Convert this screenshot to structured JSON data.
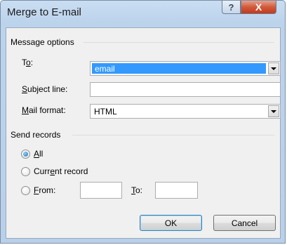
{
  "window": {
    "title": "Merge to E-mail"
  },
  "title_buttons": {
    "help_glyph": "?",
    "close_glyph": "X"
  },
  "message_options": {
    "group_label": "Message options",
    "to": {
      "label_pre": "T",
      "label_key": "o",
      "label_post": ":",
      "value": "email"
    },
    "subject": {
      "label_key": "S",
      "label_post": "ubject line:",
      "value": ""
    },
    "mail_format": {
      "label_key": "M",
      "label_post": "ail format:",
      "value": "HTML"
    }
  },
  "send_records": {
    "group_label": "Send records",
    "all": {
      "label_key": "A",
      "label_post": "ll",
      "checked": true
    },
    "current": {
      "label_pre": "Curr",
      "label_key": "e",
      "label_post": "nt record",
      "checked": false
    },
    "from": {
      "label_key": "F",
      "label_post": "rom:",
      "value": "",
      "checked": false
    },
    "to": {
      "label_key": "T",
      "label_post": "o:",
      "value": ""
    }
  },
  "buttons": {
    "ok": "OK",
    "cancel": "Cancel"
  },
  "colors": {
    "selection": "#3399ff",
    "close_button": "#c94a2c",
    "dialog_frame": "#b9d0ea"
  },
  "icons": {
    "help": "question-mark-icon",
    "close": "close-x-icon",
    "dropdown": "chevron-down-icon"
  }
}
